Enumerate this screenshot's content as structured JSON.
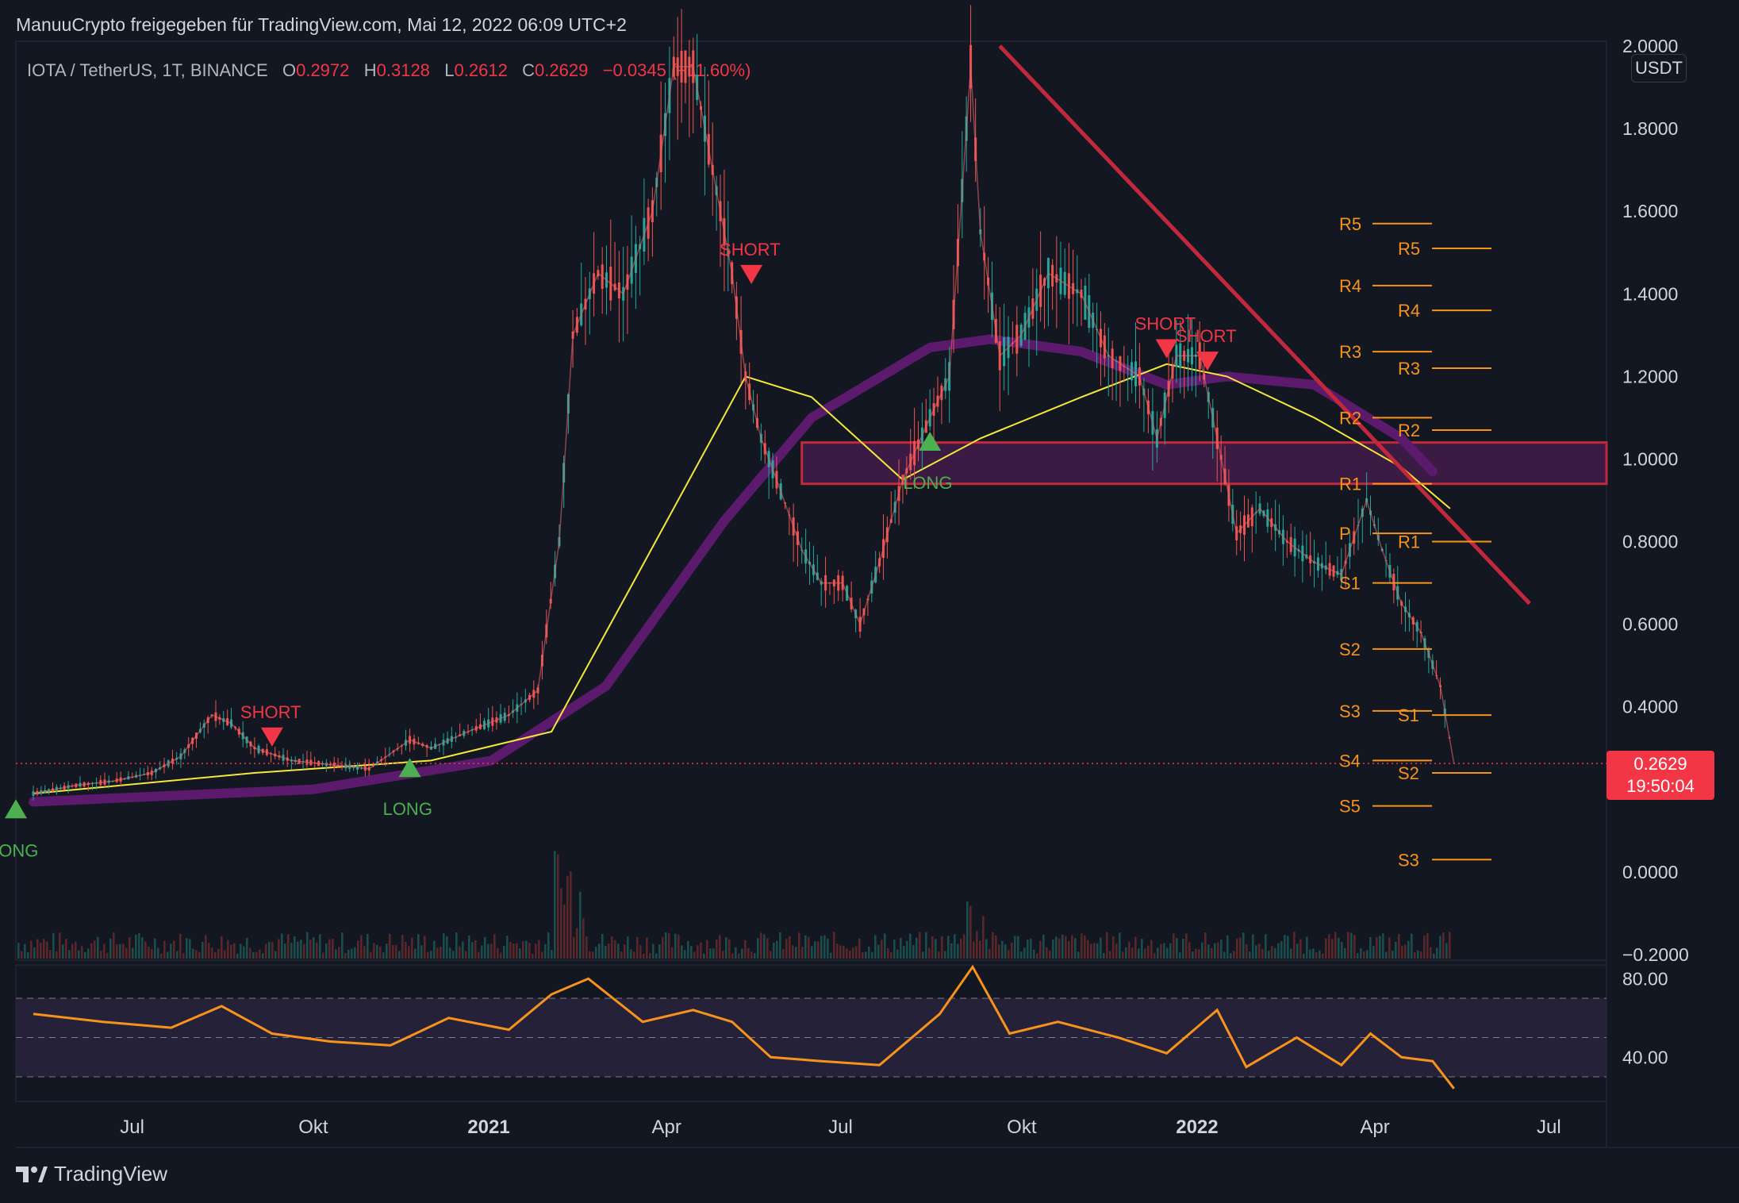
{
  "header": {
    "publisher_line": "ManuuCrypto freigegeben für TradingView.com, Mai 12, 2022 06:09 UTC+2"
  },
  "symbol_bar": {
    "symbol": "IOTA / TetherUS, 1T, BINANCE",
    "open_label": "O",
    "open": "0.2972",
    "high_label": "H",
    "high": "0.3128",
    "low_label": "L",
    "low": "0.2612",
    "close_label": "C",
    "close": "0.2629",
    "change": "−0.0345 (−11.60%)"
  },
  "currency": "USDT",
  "last_price": {
    "price": "0.2629",
    "countdown": "19:50:04"
  },
  "footer": {
    "brand": "TradingView"
  },
  "colors": {
    "background": "#131722",
    "up": "#26a69a",
    "down": "#ef5350",
    "trendline": "#c2283c",
    "resistance_zone": "#4a1d4f",
    "ma_yellow": "#f5e83a",
    "ma_purple": "#5b1a6b",
    "pivot": "#f7931a",
    "rsi": "#f7931a",
    "long_signal": "#4caf50",
    "short_signal": "#f23645"
  },
  "chart_data": [
    {
      "type": "line",
      "title": "IOTA / TetherUS, 1T, BINANCE",
      "xlabel": "",
      "ylabel": "",
      "x_ticks": [
        "Jul",
        "Okt",
        "2021",
        "Apr",
        "Jul",
        "Okt",
        "2022",
        "Apr",
        "Jul"
      ],
      "y_ticks": [
        "2.0000",
        "1.8000",
        "1.6000",
        "1.4000",
        "1.2000",
        "1.0000",
        "0.8000",
        "0.6000",
        "0.4000",
        "0.2629",
        "0.0000",
        "−0.2000"
      ],
      "y_tick_values": [
        2.0,
        1.8,
        1.6,
        1.4,
        1.2,
        1.0,
        0.8,
        0.6,
        0.4,
        0.0,
        -0.2
      ],
      "ylim": [
        -0.2,
        2.0
      ],
      "series": [
        {
          "name": "IOTA/USDT close (approx.)",
          "x": [
            "2020-05-10",
            "2020-06-01",
            "2020-06-20",
            "2020-07-10",
            "2020-07-25",
            "2020-08-10",
            "2020-08-20",
            "2020-09-01",
            "2020-09-20",
            "2020-10-10",
            "2020-10-30",
            "2020-11-20",
            "2020-12-01",
            "2020-12-20",
            "2021-01-10",
            "2021-01-25",
            "2021-02-05",
            "2021-02-12",
            "2021-02-25",
            "2021-03-10",
            "2021-03-25",
            "2021-04-05",
            "2021-04-15",
            "2021-04-25",
            "2021-05-05",
            "2021-05-12",
            "2021-05-20",
            "2021-05-28",
            "2021-06-10",
            "2021-06-20",
            "2021-07-01",
            "2021-07-10",
            "2021-07-20",
            "2021-08-01",
            "2021-08-15",
            "2021-08-25",
            "2021-09-05",
            "2021-09-10",
            "2021-09-20",
            "2021-10-01",
            "2021-10-15",
            "2021-11-01",
            "2021-11-15",
            "2021-12-01",
            "2021-12-10",
            "2021-12-20",
            "2022-01-01",
            "2022-01-10",
            "2022-01-20",
            "2022-02-01",
            "2022-02-15",
            "2022-03-01",
            "2022-03-15",
            "2022-03-28",
            "2022-04-05",
            "2022-04-15",
            "2022-04-25",
            "2022-05-05",
            "2022-05-12"
          ],
          "y": [
            0.19,
            0.21,
            0.22,
            0.24,
            0.28,
            0.38,
            0.36,
            0.3,
            0.27,
            0.26,
            0.25,
            0.32,
            0.3,
            0.34,
            0.38,
            0.44,
            0.8,
            1.3,
            1.45,
            1.4,
            1.6,
            1.95,
            1.95,
            1.7,
            1.45,
            1.2,
            1.05,
            0.95,
            0.78,
            0.7,
            0.7,
            0.6,
            0.75,
            0.95,
            1.1,
            1.2,
            1.95,
            1.55,
            1.25,
            1.3,
            1.45,
            1.4,
            1.25,
            1.2,
            1.05,
            1.25,
            1.25,
            1.05,
            0.82,
            0.88,
            0.8,
            0.75,
            0.72,
            0.9,
            0.78,
            0.65,
            0.58,
            0.45,
            0.2629
          ]
        },
        {
          "name": "MA yellow (approx.)",
          "x": [
            "2020-05-10",
            "2020-09-01",
            "2020-12-01",
            "2021-02-01",
            "2021-03-15",
            "2021-05-12",
            "2021-06-15",
            "2021-08-01",
            "2021-09-10",
            "2021-11-01",
            "2021-12-15",
            "2022-01-15",
            "2022-03-01",
            "2022-04-15",
            "2022-05-10"
          ],
          "y": [
            0.19,
            0.24,
            0.27,
            0.34,
            0.7,
            1.2,
            1.15,
            0.95,
            1.05,
            1.15,
            1.23,
            1.2,
            1.1,
            0.98,
            0.88
          ]
        },
        {
          "name": "MA purple (approx.)",
          "x": [
            "2020-05-10",
            "2020-10-01",
            "2021-01-01",
            "2021-03-01",
            "2021-05-01",
            "2021-06-15",
            "2021-08-15",
            "2021-09-15",
            "2021-11-01",
            "2021-12-15",
            "2022-01-15",
            "2022-03-01",
            "2022-04-15",
            "2022-05-01"
          ],
          "y": [
            0.17,
            0.2,
            0.27,
            0.45,
            0.85,
            1.1,
            1.27,
            1.29,
            1.26,
            1.18,
            1.2,
            1.18,
            1.05,
            0.97
          ]
        }
      ],
      "resistance_zone": {
        "from": 0.94,
        "to": 1.04
      },
      "trendline": {
        "from": [
          "2021-09-20",
          2.0
        ],
        "to": [
          "2022-06-20",
          0.65
        ]
      },
      "last_price_line": 0.2629,
      "signals": [
        {
          "label": "LONG",
          "x": "2020-05-01",
          "y": 0.13,
          "dir": "up"
        },
        {
          "label": "SHORT",
          "x": "2020-09-10",
          "y": 0.35,
          "dir": "down"
        },
        {
          "label": "LONG",
          "x": "2020-11-20",
          "y": 0.23,
          "dir": "up"
        },
        {
          "label": "SHORT",
          "x": "2021-05-15",
          "y": 1.47,
          "dir": "down"
        },
        {
          "label": "LONG",
          "x": "2021-08-15",
          "y": 1.02,
          "dir": "up"
        },
        {
          "label": "SHORT",
          "x": "2021-12-15",
          "y": 1.29,
          "dir": "down"
        },
        {
          "label": "SHORT",
          "x": "2022-01-05",
          "y": 1.26,
          "dir": "down"
        }
      ],
      "pivots_left": [
        {
          "label": "R5",
          "value": 1.57
        },
        {
          "label": "R4",
          "value": 1.42
        },
        {
          "label": "R3",
          "value": 1.26
        },
        {
          "label": "R2",
          "value": 1.1
        },
        {
          "label": "R1",
          "value": 0.94
        },
        {
          "label": "P",
          "value": 0.82
        },
        {
          "label": "S1",
          "value": 0.7
        },
        {
          "label": "S2",
          "value": 0.54
        },
        {
          "label": "S3",
          "value": 0.39
        },
        {
          "label": "S4",
          "value": 0.27
        },
        {
          "label": "S5",
          "value": 0.16
        }
      ],
      "pivots_right": [
        {
          "label": "R5",
          "value": 1.51
        },
        {
          "label": "R4",
          "value": 1.36
        },
        {
          "label": "R3",
          "value": 1.22
        },
        {
          "label": "R2",
          "value": 1.07
        },
        {
          "label": "R1",
          "value": 0.8
        },
        {
          "label": "S1",
          "value": 0.38
        },
        {
          "label": "S2",
          "value": 0.24
        },
        {
          "label": "S3",
          "value": 0.03
        }
      ]
    },
    {
      "type": "line",
      "title": "",
      "xlabel": "",
      "ylabel": "",
      "y_ticks": [
        "80.00",
        "40.00"
      ],
      "y_tick_values": [
        80,
        40
      ],
      "ylim": [
        20,
        95
      ],
      "band": [
        30,
        70
      ],
      "series": [
        {
          "name": "RSI (approx.)",
          "x": [
            "2020-05-10",
            "2020-06-15",
            "2020-07-20",
            "2020-08-15",
            "2020-09-10",
            "2020-10-10",
            "2020-11-10",
            "2020-12-10",
            "2021-01-10",
            "2021-02-01",
            "2021-02-20",
            "2021-03-20",
            "2021-04-15",
            "2021-05-05",
            "2021-05-25",
            "2021-06-20",
            "2021-07-20",
            "2021-08-20",
            "2021-09-06",
            "2021-09-25",
            "2021-10-20",
            "2021-11-20",
            "2021-12-15",
            "2022-01-10",
            "2022-01-25",
            "2022-02-20",
            "2022-03-15",
            "2022-03-30",
            "2022-04-15",
            "2022-05-01",
            "2022-05-12"
          ],
          "y": [
            62,
            58,
            55,
            66,
            52,
            48,
            46,
            60,
            54,
            72,
            80,
            58,
            64,
            58,
            40,
            38,
            36,
            62,
            86,
            52,
            58,
            50,
            42,
            64,
            35,
            50,
            36,
            52,
            40,
            38,
            24
          ]
        }
      ]
    }
  ]
}
